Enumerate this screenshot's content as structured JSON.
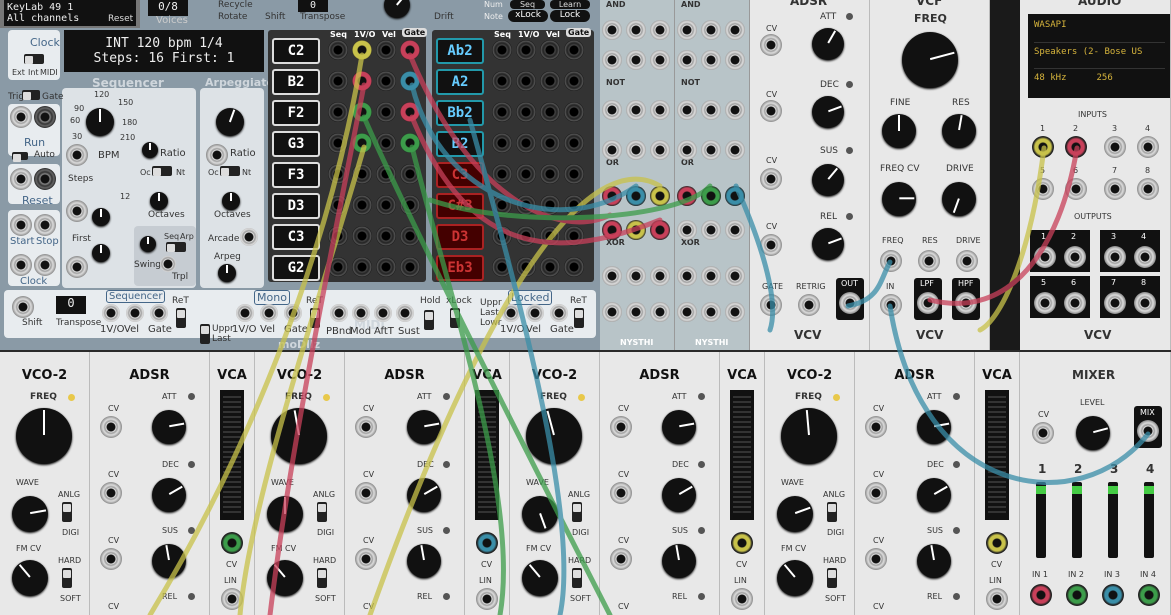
{
  "keylab": {
    "line1": "KeyLab 49 1",
    "line2": "All channels",
    "reset": "Reset"
  },
  "top": {
    "voices": "0/8",
    "voices_lbl": "Voices",
    "recycle": "Recycle",
    "rotate": "Rotate",
    "shift": "Shift",
    "transpose": "Transpose",
    "transpose_val": "0",
    "drift": "Drift",
    "num": "Num",
    "note": "Note",
    "seq": "Seq",
    "learn": "Learn",
    "xlock": "xLock",
    "lock": "Lock"
  },
  "modllz": {
    "clock": "Clock",
    "ext": "Ext",
    "int": "Int",
    "midi": "MIDI",
    "display1": "INT 120 bpm 1/4",
    "display2": "Steps: 16 First: 1",
    "sequencer": "Sequencer",
    "arpeggiator": "Arpeggiator",
    "bpm": "BPM",
    "ratio": "Ratio",
    "steps": "Steps",
    "first": "First",
    "oc": "Oc",
    "nt": "Nt",
    "octaves": "Octaves",
    "trig": "Trig",
    "gate": "Gate",
    "run": "Run",
    "auto": "Auto",
    "reset": "Reset",
    "start": "Start",
    "stop": "Stop",
    "clock2": "Clock",
    "swing": "Swing",
    "trpl": "Trpl",
    "seq2": "Seq",
    "arp": "Arp",
    "arcade": "Arcade",
    "arpeg": "Arpeg",
    "col_seq": "Seq",
    "col_1vo": "1V/O",
    "col_vel": "Vel",
    "col_gate": "Gate",
    "notes_left": [
      "C2",
      "B2",
      "F2",
      "G3",
      "F3",
      "D3",
      "C3",
      "G2"
    ],
    "notes_right": [
      "Ab2",
      "A2",
      "Bb2",
      "B2",
      "C3",
      "C#3",
      "D3",
      "Eb3"
    ],
    "bpm_ticks": [
      "30",
      "60",
      "90",
      "120",
      "150",
      "180",
      "210"
    ],
    "shift": "Shift",
    "transpose": "Transpose",
    "transpose_val": "0",
    "sequencer2": "Sequencer",
    "ret": "ReT",
    "mono": "Mono",
    "midi2": "MIDI",
    "locked": "Locked",
    "uppr": "Uppr",
    "last": "Last",
    "lowr": "Lowr",
    "pbnd": "PBnd",
    "mod": "Mod",
    "afft": "AftT",
    "sust": "Sust",
    "hold": "Hold",
    "xlock": "xLock",
    "brand": "moDllz",
    "bot_1vo": "1V/O",
    "bot_vel": "Vel",
    "bot_gate": "Gate"
  },
  "nysthi": {
    "and": "AND",
    "not": "NOT",
    "or": "OR",
    "xor": "XOR",
    "brand": "NYSTHI"
  },
  "adsr_top": {
    "title": "ADSR",
    "cv": "CV",
    "att": "ATT",
    "dec": "DEC",
    "sus": "SUS",
    "rel": "REL",
    "gate": "GATE",
    "retrig": "RETRIG",
    "out": "OUT",
    "brand": "VCV"
  },
  "vcf": {
    "title": "VCF",
    "freq": "FREQ",
    "fine": "FINE",
    "res": "RES",
    "freqcv": "FREQ CV",
    "drive": "DRIVE",
    "in_freq": "FREQ",
    "in_res": "RES",
    "in_drive": "DRIVE",
    "in": "IN",
    "lpf": "LPF",
    "hpf": "HPF",
    "brand": "VCV"
  },
  "audio": {
    "title": "AUDIO",
    "driver": "WASAPI",
    "device": "Speakers (2- Bose US",
    "rate": "48 kHz",
    "block": "256",
    "inputs": "INPUTS",
    "outputs": "OUTPUTS",
    "nums": [
      "1",
      "2",
      "3",
      "4",
      "5",
      "6",
      "7",
      "8"
    ],
    "brand": "VCV"
  },
  "voices": [
    {
      "vco": "VCO-2",
      "freq": "FREQ",
      "wave": "WAVE",
      "anlg": "ANLG",
      "digi": "DIGI",
      "fmcv": "FM CV",
      "hard": "HARD",
      "soft": "SOFT",
      "adsr": "ADSR",
      "cv": "CV",
      "att": "ATT",
      "dec": "DEC",
      "sus": "SUS",
      "rel": "REL",
      "vca": "VCA",
      "lin": "LIN"
    },
    {
      "vco": "VCO-2",
      "freq": "FREQ",
      "wave": "WAVE",
      "anlg": "ANLG",
      "digi": "DIGI",
      "fmcv": "FM CV",
      "hard": "HARD",
      "soft": "SOFT",
      "adsr": "ADSR",
      "cv": "CV",
      "att": "ATT",
      "dec": "DEC",
      "sus": "SUS",
      "rel": "REL",
      "vca": "VCA",
      "lin": "LIN"
    },
    {
      "vco": "VCO-2",
      "freq": "FREQ",
      "wave": "WAVE",
      "anlg": "ANLG",
      "digi": "DIGI",
      "fmcv": "FM CV",
      "hard": "HARD",
      "soft": "SOFT",
      "adsr": "ADSR",
      "cv": "CV",
      "att": "ATT",
      "dec": "DEC",
      "sus": "SUS",
      "rel": "REL",
      "vca": "VCA",
      "lin": "LIN"
    },
    {
      "vco": "VCO-2",
      "freq": "FREQ",
      "wave": "WAVE",
      "anlg": "ANLG",
      "digi": "DIGI",
      "fmcv": "FM CV",
      "hard": "HARD",
      "soft": "SOFT",
      "adsr": "ADSR",
      "cv": "CV",
      "att": "ATT",
      "dec": "DEC",
      "sus": "SUS",
      "rel": "REL",
      "vca": "VCA",
      "lin": "LIN"
    }
  ],
  "mixer": {
    "title": "MIXER",
    "level": "LEVEL",
    "cv": "CV",
    "mix": "MIX",
    "ch": [
      "1",
      "2",
      "3",
      "4"
    ],
    "ins": [
      "IN 1",
      "IN 2",
      "IN 3",
      "IN 4"
    ]
  },
  "colors": {
    "cable_yellow": "#c8c24a",
    "cable_red": "#c8405a",
    "cable_green": "#3c9c4a",
    "cable_blue": "#3a8ea8",
    "panel": "#e8e8e8",
    "modllz_bg": "#8a9aa6"
  }
}
